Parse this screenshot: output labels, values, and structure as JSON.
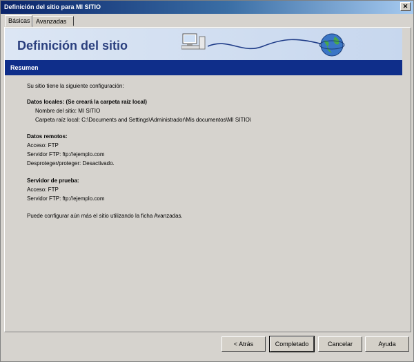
{
  "window": {
    "title": "Definición del sitio para MI SITIO"
  },
  "tabs": [
    {
      "label": "Básicas"
    },
    {
      "label": "Avanzadas"
    }
  ],
  "banner": {
    "title": "Definición del sitio"
  },
  "section": {
    "label": "Resumen"
  },
  "summary": {
    "intro": "Su sitio tiene la siguiente configuración:",
    "local": {
      "heading": "Datos locales: (Se creará la carpeta raíz local)",
      "name": "Nombre del sitio: MI SITIO",
      "folder": "Carpeta raíz local: C:\\Documents and Settings\\Administrador\\Mis documentos\\MI SITIO\\"
    },
    "remote": {
      "heading": "Datos remotos:",
      "access": "Acceso: FTP",
      "server": "Servidor FTP: ftp://ejemplo.com",
      "protect": "Desproteger/proteger: Desactivado."
    },
    "test": {
      "heading": "Servidor de prueba:",
      "access": "Acceso: FTP",
      "server": "Servidor FTP: ftp://ejemplo.com"
    },
    "footer": "Puede configurar aún más el sitio utilizando la ficha Avanzadas."
  },
  "buttons": {
    "back": "< Atrás",
    "done": "Completado",
    "cancel": "Cancelar",
    "help": "Ayuda"
  },
  "icons": {
    "computer": "computer-icon",
    "globe": "globe-icon",
    "close": "close-icon"
  },
  "colors": {
    "title_bar": "#0a246a",
    "section_bar": "#0f2e8a",
    "banner_text": "#2a3f7e"
  }
}
